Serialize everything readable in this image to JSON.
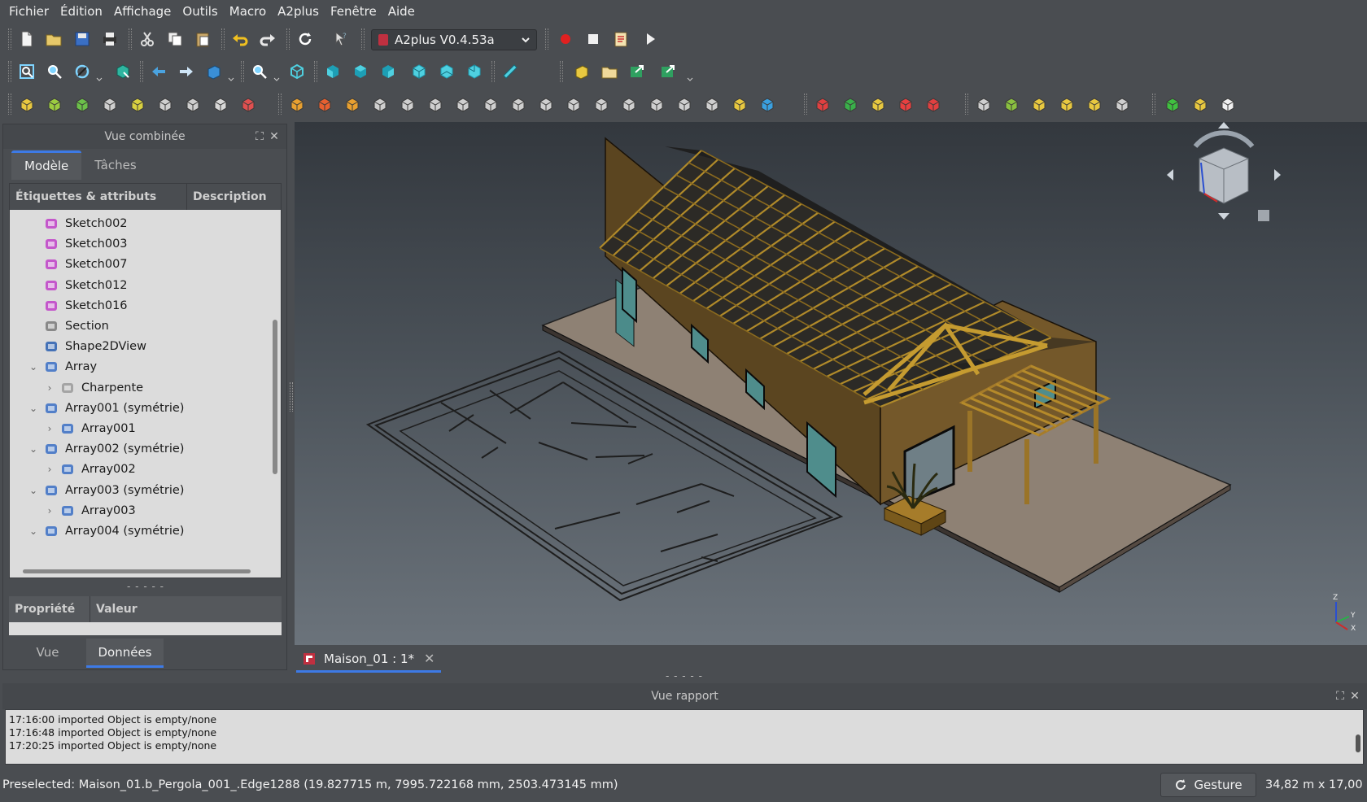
{
  "menubar": [
    "Fichier",
    "Édition",
    "Affichage",
    "Outils",
    "Macro",
    "A2plus",
    "Fenêtre",
    "Aide"
  ],
  "workbench": {
    "selected": "A2plus V0.4.53a"
  },
  "combo": {
    "title": "Vue combinée",
    "tabs": [
      "Modèle",
      "Tâches"
    ],
    "tree_headers": {
      "labels": "Étiquettes & attributs",
      "description": "Description"
    },
    "tree_items": [
      {
        "label": "Sketch002",
        "icon": "sketch-icon",
        "twisty": ""
      },
      {
        "label": "Sketch003",
        "icon": "sketch-icon",
        "twisty": ""
      },
      {
        "label": "Sketch007",
        "icon": "sketch-icon",
        "twisty": ""
      },
      {
        "label": "Sketch012",
        "icon": "sketch-icon",
        "twisty": ""
      },
      {
        "label": "Sketch016",
        "icon": "sketch-icon",
        "twisty": ""
      },
      {
        "label": "Section",
        "icon": "section-icon",
        "twisty": ""
      },
      {
        "label": "Shape2DView",
        "icon": "shape2dview-icon",
        "twisty": ""
      },
      {
        "label": "Array",
        "icon": "array-icon",
        "twisty": "⌄"
      },
      {
        "label": "Charpente",
        "icon": "group-icon",
        "twisty": "›"
      },
      {
        "label": "Array001 (symétrie)",
        "icon": "mirror-array-icon",
        "twisty": "⌄"
      },
      {
        "label": "Array001",
        "icon": "array-icon",
        "twisty": "›"
      },
      {
        "label": "Array002 (symétrie)",
        "icon": "mirror-array-icon",
        "twisty": "⌄"
      },
      {
        "label": "Array002",
        "icon": "array-icon",
        "twisty": "›"
      },
      {
        "label": "Array003 (symétrie)",
        "icon": "mirror-array-icon",
        "twisty": "⌄"
      },
      {
        "label": "Array003",
        "icon": "array-icon",
        "twisty": "›"
      },
      {
        "label": "Array004 (symétrie)",
        "icon": "mirror-array-icon",
        "twisty": "⌄"
      }
    ],
    "property_headers": {
      "property": "Propriété",
      "value": "Valeur"
    },
    "bottom_tabs": [
      "Vue",
      "Données"
    ]
  },
  "document_tab": {
    "label": "Maison_01 : 1*"
  },
  "report": {
    "title": "Vue rapport",
    "lines": [
      "17:16:00  imported Object is empty/none",
      "17:16:48  imported Object is empty/none",
      "17:20:25  imported Object is empty/none"
    ]
  },
  "status": {
    "preselected": "Preselected: Maison_01.b_Pergola_001_.Edge1288 (19.827715 m, 7995.722168 mm, 2503.473145 mm)",
    "navigation_style": "Gesture",
    "dimensions": "34,82 m x 17,00 m"
  },
  "axis_labels": {
    "z": "Z",
    "y": "Y",
    "x": "X"
  },
  "toolbar_icons": {
    "row1": [
      "new-document-icon",
      "open-icon",
      "save-icon",
      "print-icon",
      "cut-icon",
      "copy-icon",
      "paste-icon",
      "undo-icon",
      "redo-icon",
      "refresh-icon",
      "whats-this-icon",
      "record-macro-icon",
      "stop-macro-icon",
      "edit-macro-icon",
      "run-macro-icon"
    ],
    "row2": [
      "fit-all-icon",
      "fit-selection-icon",
      "draw-style-icon",
      "bounding-box-icon",
      "back-icon",
      "forward-icon",
      "std-views-icon",
      "zoom-icon",
      "isometric-icon",
      "front-view-icon",
      "top-view-icon",
      "right-view-icon",
      "rear-view-icon",
      "bottom-view-icon",
      "left-view-icon",
      "measure-icon",
      "part-icon",
      "group-icon",
      "link-icon",
      "link-actions-icon"
    ],
    "row3": [
      "a2p-import-icon",
      "a2p-update-icon",
      "a2p-duplicate-icon",
      "a2p-convert-icon",
      "a2p-move-icon",
      "a2p-fix-icon",
      "a2p-unfix-icon",
      "a2p-lock-icon",
      "a2p-solve-icon",
      "point-constraint-icon",
      "point-on-line-icon",
      "point-on-plane-icon",
      "delete-constraint-icon",
      "sphere-constraint-icon",
      "circular-edge-icon",
      "plane-constraint-icon",
      "angled-planes-icon",
      "axis-coincident-icon",
      "axis-parallel-icon",
      "axis-plane-parallel-icon",
      "axis-plane-normal-icon",
      "axis-plane-angle-icon",
      "planes-parallel-icon",
      "plane-coincident-icon",
      "angle-constraint-icon",
      "center-of-mass-icon",
      "partial-processing-icon",
      "auto-solve-icon",
      "flip-constraint-icon",
      "tree-view-icon",
      "constraint-viewer-icon",
      "bom-icon",
      "search-icon",
      "convert-part-icon",
      "isolate-icon",
      "label-icon",
      "highlight-icon",
      "toggle-transparency-icon",
      "add-part-icon",
      "parts-info-icon",
      "parts-list-icon"
    ]
  }
}
